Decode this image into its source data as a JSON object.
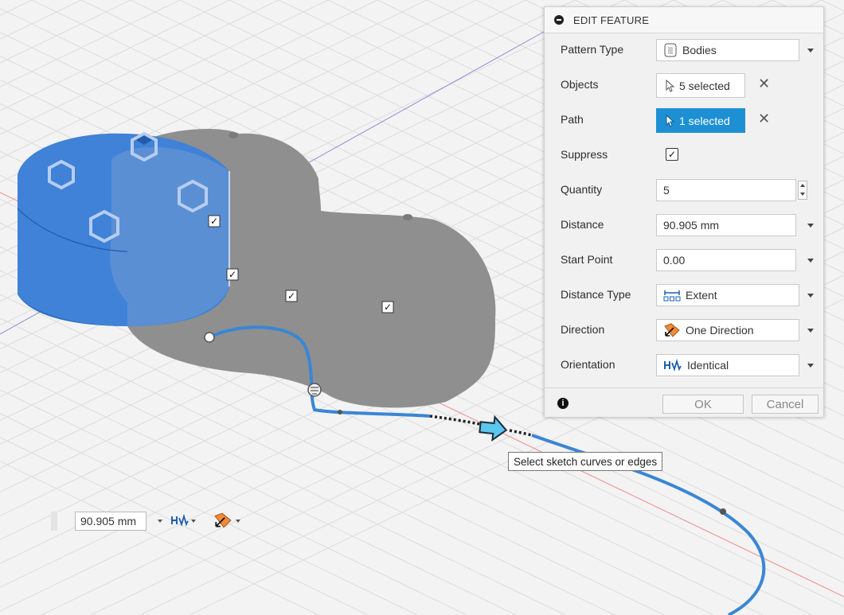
{
  "panel": {
    "title": "EDIT FEATURE",
    "rows": {
      "pattern_type": {
        "label": "Pattern Type",
        "value": "Bodies"
      },
      "objects": {
        "label": "Objects",
        "value": "5 selected"
      },
      "path": {
        "label": "Path",
        "value": "1 selected"
      },
      "suppress": {
        "label": "Suppress",
        "checked": true
      },
      "quantity": {
        "label": "Quantity",
        "value": "5"
      },
      "distance": {
        "label": "Distance",
        "value": "90.905 mm"
      },
      "start_point": {
        "label": "Start Point",
        "value": "0.00"
      },
      "distance_type": {
        "label": "Distance Type",
        "value": "Extent",
        "icon": "extent-icon"
      },
      "direction": {
        "label": "Direction",
        "value": "One Direction",
        "icon": "one-direction-icon"
      },
      "orientation": {
        "label": "Orientation",
        "value": "Identical",
        "icon": "identical-orientation-icon"
      }
    },
    "ok_label": "OK",
    "cancel_label": "Cancel"
  },
  "tooltip": "Select sketch curves or edges",
  "mini_toolbar": {
    "distance_value": "90.905 mm"
  },
  "colors": {
    "accent": "#1d90d3",
    "path_curve": "#3a86d4",
    "selected_body": "#2f6fc2",
    "pattern_body": "#8f8f8f",
    "direction_icon": "#f08c3a"
  }
}
